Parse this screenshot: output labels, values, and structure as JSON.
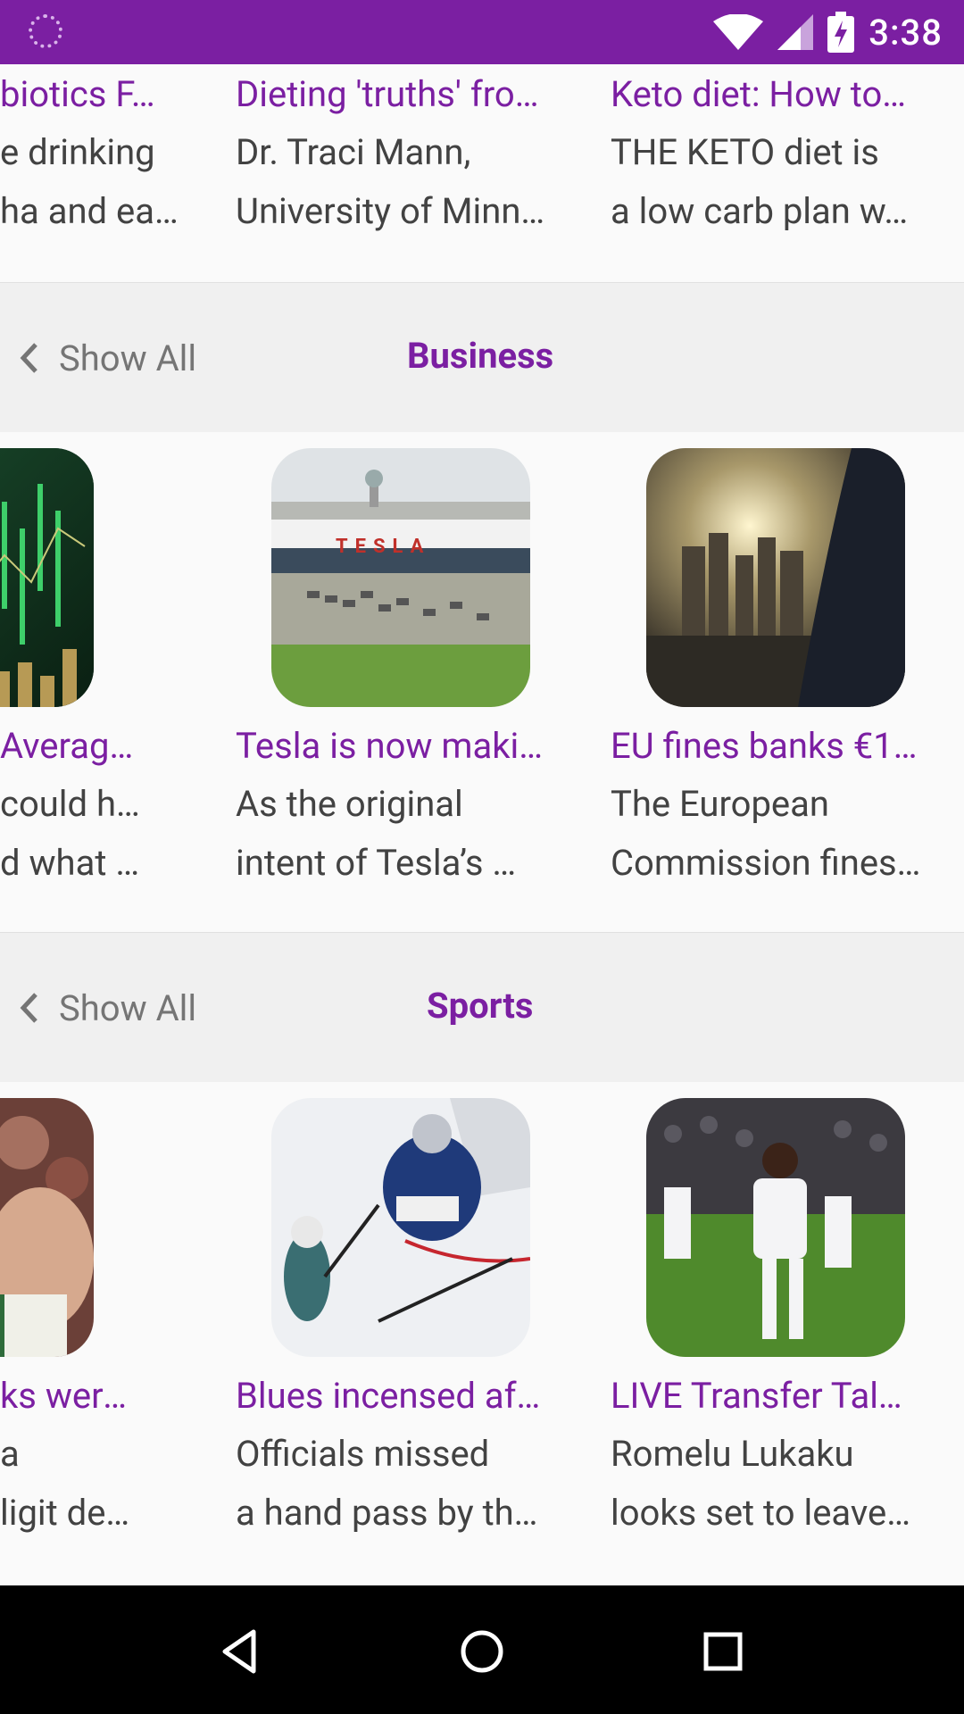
{
  "status_bar": {
    "time": "3:38",
    "icons": [
      "app-notification-icon",
      "wifi-icon",
      "cellular-signal-icon",
      "battery-charging-icon"
    ]
  },
  "top_row": [
    {
      "title": "biotics F…",
      "desc": [
        "e drinking",
        "ha and ea…"
      ]
    },
    {
      "title": "Dieting 'truths' fro…",
      "desc": [
        "Dr. Traci Mann,",
        "University of Minn…"
      ]
    },
    {
      "title": "Keto diet: How to…",
      "desc": [
        "THE KETO diet is",
        "a low carb plan w…"
      ]
    }
  ],
  "business": {
    "show_all": "Show All",
    "title": "Business",
    "cards": [
      {
        "title": "Averages…",
        "desc": [
          "could have",
          "d what ha…"
        ],
        "image": "stock-chart-image"
      },
      {
        "title": "Tesla is now maki…",
        "desc": [
          "As the original",
          "intent of Tesla’s …"
        ],
        "image": "tesla-factory-image",
        "sign": "TESLA"
      },
      {
        "title": "EU fines banks €1…",
        "desc": [
          "The European",
          "Commission fines…"
        ],
        "image": "city-skyline-image"
      }
    ]
  },
  "sports": {
    "show_all": "Show All",
    "title": "Sports",
    "cards": [
      {
        "title": "ks weren't…",
        "desc": [
          "a",
          "ligit defici…"
        ],
        "image": "basketball-player-image"
      },
      {
        "title": "Blues incensed af…",
        "desc": [
          "Officials missed",
          "a hand pass by th…"
        ],
        "image": "hockey-goalie-image"
      },
      {
        "title": "LIVE Transfer Tal…",
        "desc": [
          "Romelu Lukaku",
          "looks set to leave…"
        ],
        "image": "soccer-player-image"
      }
    ]
  },
  "nav_bar": {
    "buttons": [
      "back-icon",
      "home-icon",
      "recents-icon"
    ]
  },
  "colors": {
    "accent": "#7b1fa2",
    "status_bar": "#7b1fa2",
    "text": "#424242",
    "muted": "#757575"
  }
}
